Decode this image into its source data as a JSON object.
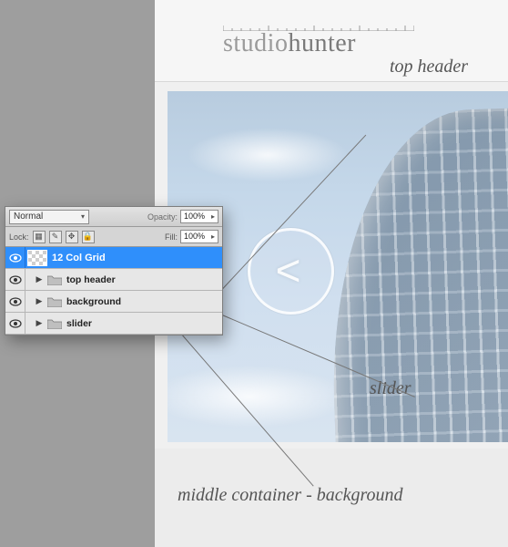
{
  "site": {
    "logo_prefix": "studio",
    "logo_suffix": "hunter"
  },
  "annotations": {
    "top_header": "top header",
    "slider": "slider",
    "middle": "middle container - background"
  },
  "panel": {
    "blend_mode": "Normal",
    "opacity_label": "Opacity:",
    "opacity_value": "100%",
    "lock_label": "Lock:",
    "fill_label": "Fill:",
    "fill_value": "100%",
    "layers": [
      {
        "name": "12 Col Grid",
        "type": "layer",
        "selected": true
      },
      {
        "name": "top header",
        "type": "group",
        "selected": false
      },
      {
        "name": "background",
        "type": "group",
        "selected": false
      },
      {
        "name": "slider",
        "type": "group",
        "selected": false
      }
    ]
  }
}
